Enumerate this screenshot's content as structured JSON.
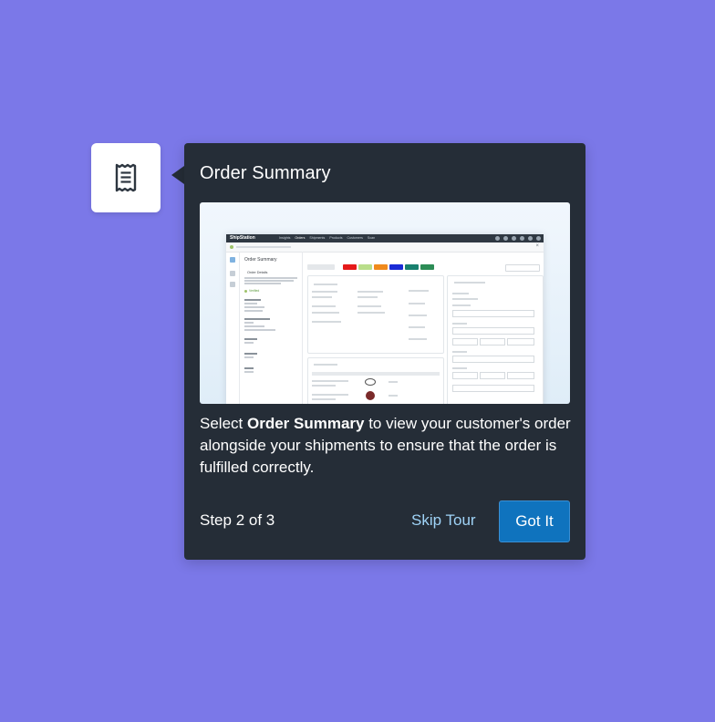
{
  "tooltip": {
    "title": "Order Summary",
    "body_prefix": "Select ",
    "body_bold": "Order Summary",
    "body_suffix": " to view your customer's order alongside your shipments to ensure that the order is fulfilled correctly.",
    "step_text": "Step 2 of 3",
    "skip_label": "Skip Tour",
    "primary_label": "Got It"
  },
  "anchor_icon": "receipt-icon",
  "preview": {
    "brand": "ShipStation",
    "nav": [
      "Insights",
      "Orders",
      "Shipments",
      "Products",
      "Customers",
      "Scan"
    ],
    "active_nav": "Orders",
    "panel_title": "Order Summary",
    "section": "Order Details",
    "verified": "Verified"
  },
  "colors": {
    "background": "#7b78e8",
    "tooltip_bg": "#252d37",
    "primary_button": "#0f73be",
    "link": "#9fd3f7"
  }
}
